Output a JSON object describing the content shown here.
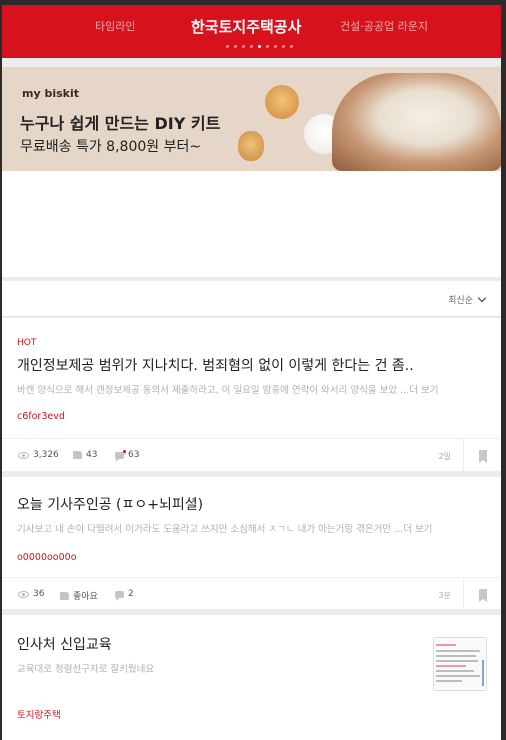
{
  "header": {
    "tab_left": "타임라인",
    "tab_main": "한국토지주택공사",
    "tab_right": "건설·공공업 라운지",
    "page_dots": 9,
    "active_dot": 4
  },
  "ad": {
    "brand": "my biskit",
    "headline": "누구나 쉽게 만드는 DIY 키트",
    "subline": "무료배송 특가 8,800원 부터~"
  },
  "sort": {
    "label": "최신순"
  },
  "posts": [
    {
      "badge": "HOT",
      "title": "개인정보제공 범위가 지나치다. 범죄혐의 없이 이렇게 한다는 건 좀..",
      "excerpt": "바캔 양식으로 해서 갠정보제공 동의서 제출하라고, 이 일요일 밤중에 연락이 와서리 양식을 보았",
      "more": "...더 보기",
      "author": "c6for3evd",
      "views": "3,326",
      "likes": "43",
      "comments": "63",
      "time": "2일"
    },
    {
      "badge": "",
      "title": "오늘 기사주인공 (ㅍㅇ+뇌피셜)",
      "excerpt": "기사보고 내 손이 다떨려서 이거라도 도움라고 쓰지만 소심해서 ㅈㄱㄴ  내가 아는거랑 겪은거만",
      "more": "...더 보기",
      "author": "o0000oo00o",
      "views": "36",
      "likes": "좋아요",
      "comments": "2",
      "time": "3분"
    },
    {
      "badge": "",
      "title": "인사처 신입교육",
      "excerpt": "교육대로 청렴선구자로 잘키웠네요",
      "more": "",
      "author": "토지랑주택",
      "views": "",
      "likes": "",
      "comments": "",
      "time": ""
    }
  ]
}
